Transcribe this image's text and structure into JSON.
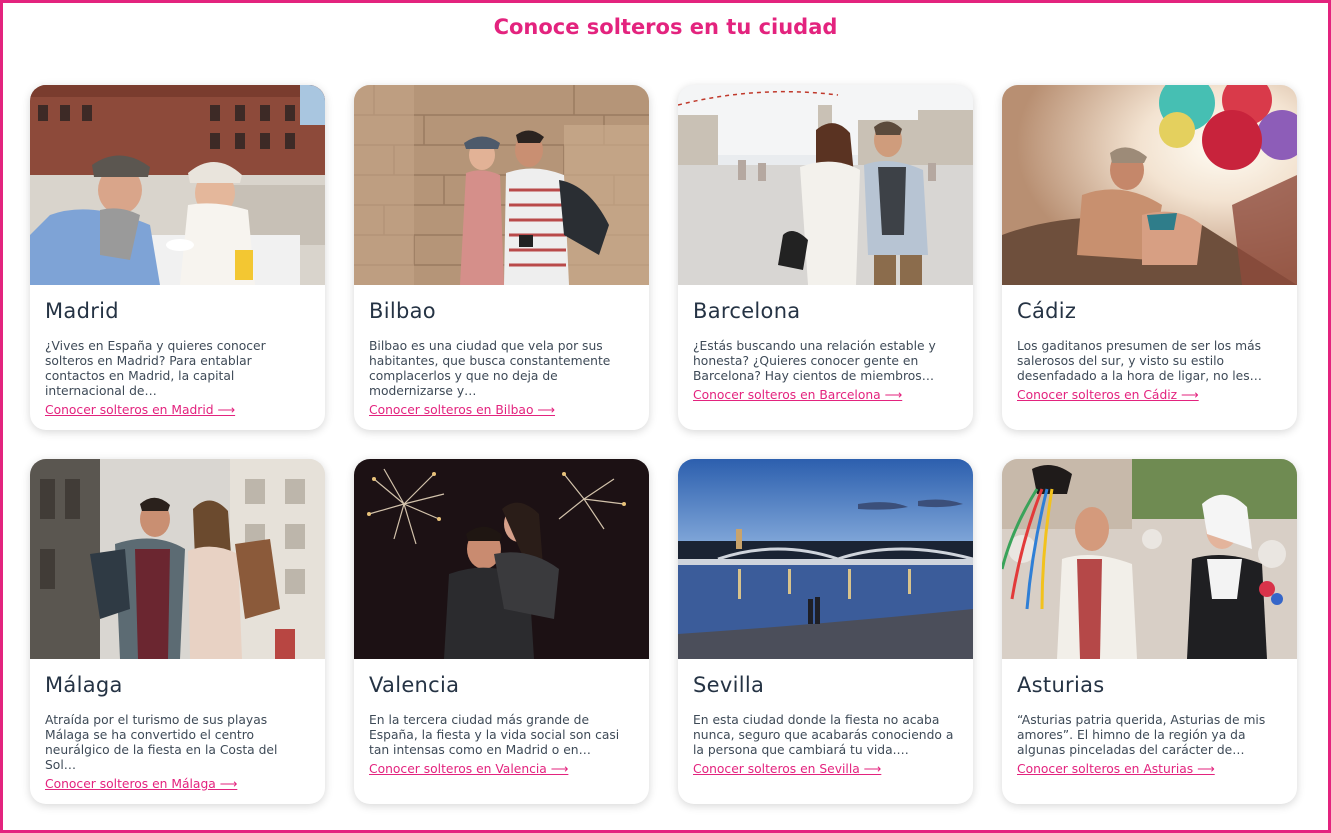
{
  "section": {
    "title": "Conoce solteros en tu ciudad"
  },
  "colors": {
    "accent": "#e3237e",
    "heading": "#253344",
    "text": "#3e4a57"
  },
  "cities": [
    {
      "name": "Madrid",
      "description": "¿Vives en España y quieres conocer solteros en Madrid? Para entablar contactos en Madrid, la capital internacional de…",
      "link": "Conocer solteros en Madrid ⟶",
      "photo_icon": "couple-cafe-plaza-photo"
    },
    {
      "name": "Bilbao",
      "description": "Bilbao es una ciudad que vela por sus habitantes, que busca constantemente complacerlos y que no deja de modernizarse y…",
      "link": "Conocer solteros en Bilbao ⟶",
      "photo_icon": "couple-stone-wall-photo"
    },
    {
      "name": "Barcelona",
      "description": "¿Estás buscando una relación estable y honesta? ¿Quieres conocer gente en Barcelona? Hay cientos de miembros…",
      "link": "Conocer solteros en Barcelona ⟶",
      "photo_icon": "couple-walking-square-photo"
    },
    {
      "name": "Cádiz",
      "description": "Los gaditanos presumen de ser los más salerosos del sur, y visto su estilo desenfadado a la hora de ligar, no les…",
      "link": "Conocer solteros en Cádiz ⟶",
      "photo_icon": "couple-beach-balloons-photo"
    },
    {
      "name": "Málaga",
      "description": "Atraída por el turismo de sus playas Málaga se ha convertido el centro neurálgico de la fiesta en la Costa del Sol…",
      "link": "Conocer solteros en Málaga ⟶",
      "photo_icon": "couple-shopping-street-photo"
    },
    {
      "name": "Valencia",
      "description": "En la tercera ciudad más grande de España, la fiesta y la vida social son casi tan intensas como en Madrid o en…",
      "link": "Conocer solteros en Valencia ⟶",
      "photo_icon": "couple-fireworks-photo"
    },
    {
      "name": "Sevilla",
      "description": "En esta ciudad donde la fiesta no acaba nunca, seguro que acabarás conociendo a la persona que cambiará tu vida.…",
      "link": "Conocer solteros en Sevilla ⟶",
      "photo_icon": "river-bridge-dusk-photo"
    },
    {
      "name": "Asturias",
      "description": "“Asturias patria querida, Asturias de mis amores”. El himno de la región ya da algunas pinceladas del carácter de…",
      "link": "Conocer solteros en Asturias ⟶",
      "photo_icon": "folk-festival-couple-photo"
    }
  ]
}
